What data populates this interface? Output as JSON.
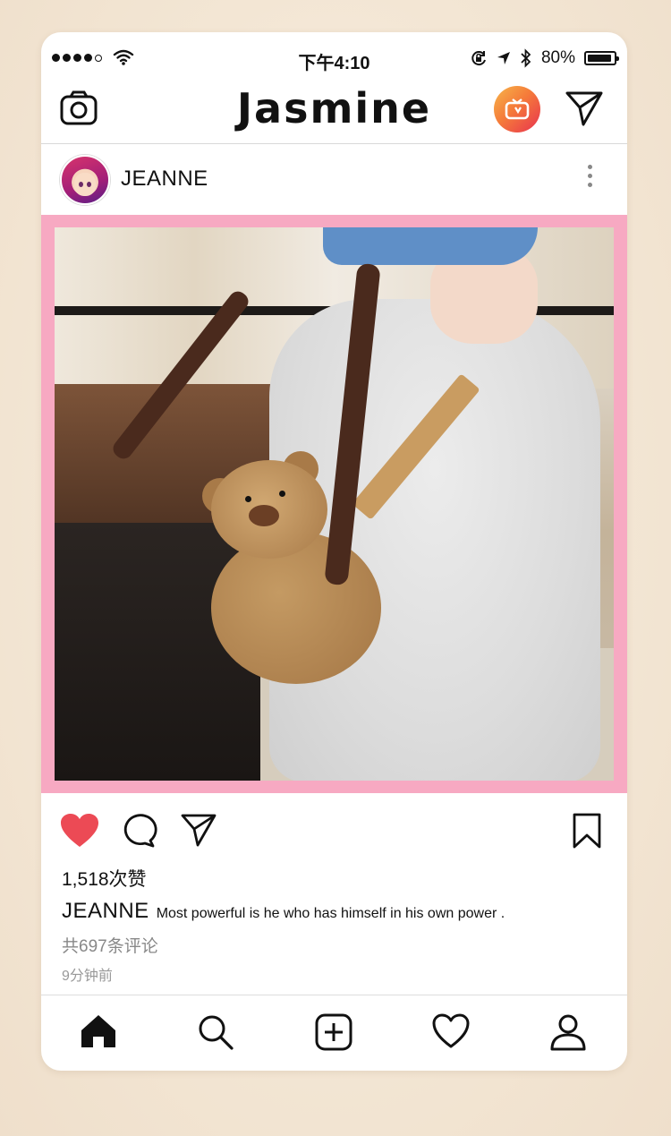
{
  "status_bar": {
    "time": "下午4:10",
    "battery": "80%",
    "battery_level": 0.8
  },
  "header": {
    "title": "Jasmine",
    "icons": [
      "camera-icon",
      "igtv-icon",
      "direct-send-icon"
    ]
  },
  "post": {
    "username": "JEANNE",
    "likes": "1,518次赞",
    "caption_user": "JEANNE",
    "caption_text": "Most powerful is he who has himself in his own power .",
    "comments": "共697条评论",
    "time_ago": "9分钟前",
    "liked": true
  },
  "colors": {
    "frame_pink": "#f7a9c2",
    "like_red": "#ec4a55",
    "background": "#f3e6d4"
  },
  "tab_bar": {
    "icons": [
      "home-icon",
      "search-icon",
      "add-post-icon",
      "activity-heart-icon",
      "profile-icon"
    ]
  }
}
